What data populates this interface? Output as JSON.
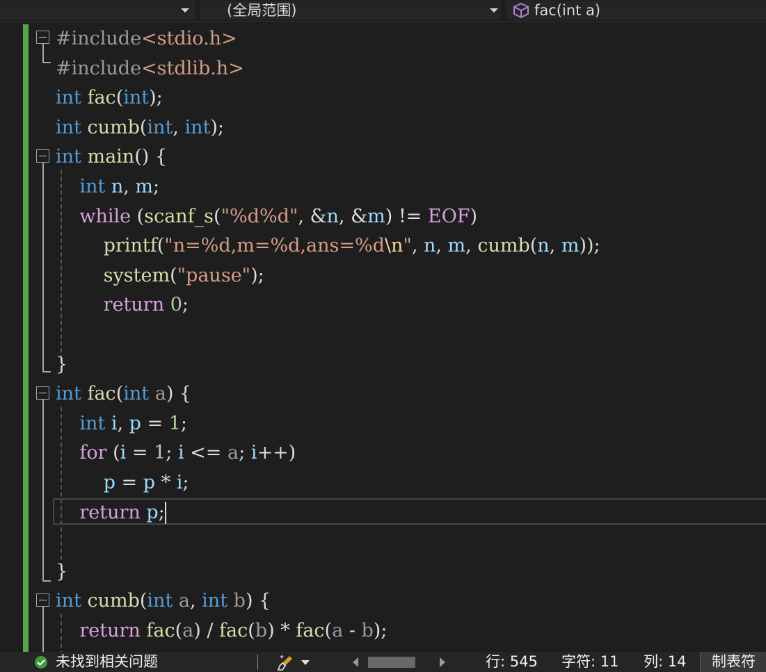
{
  "navbar": {
    "project_dropdown": "",
    "scope": "(全局范围)",
    "member": "fac(int a)",
    "member_icon": "cube-method-icon"
  },
  "code_lines": [
    "#include<stdio.h>",
    "#include<stdlib.h>",
    "int fac(int);",
    "int cumb(int, int);",
    "int main() {",
    "    int n, m;",
    "    while (scanf_s(\"%d%d\", &n, &m) != EOF)",
    "        printf(\"n=%d,m=%d,ans=%d\\n\", n, m, cumb(n, m));",
    "        system(\"pause\");",
    "        return 0;",
    "",
    "}",
    "int fac(int a) {",
    "    int i, p = 1;",
    "    for (i = 1; i <= a; i++)",
    "        p = p * i;",
    "    return p;",
    "",
    "}",
    "int cumb(int a, int b) {",
    "    return fac(a) / fac(b) * fac(a - b);"
  ],
  "current_line": 17,
  "status": {
    "issues_icon": "check-circle-icon",
    "issues_text": "未找到相关问题",
    "cleanup_icon": "brush-icon",
    "line": "行: 545",
    "char": "字符: 11",
    "col": "列: 14",
    "tab_mode": "制表符"
  },
  "colors": {
    "background": "#1e1e1e",
    "keyword": "#569cd6",
    "control": "#d8a0df",
    "function": "#dcdcaa",
    "string": "#d69d85",
    "number": "#b5cea8",
    "change_bar": "#57a64a"
  }
}
